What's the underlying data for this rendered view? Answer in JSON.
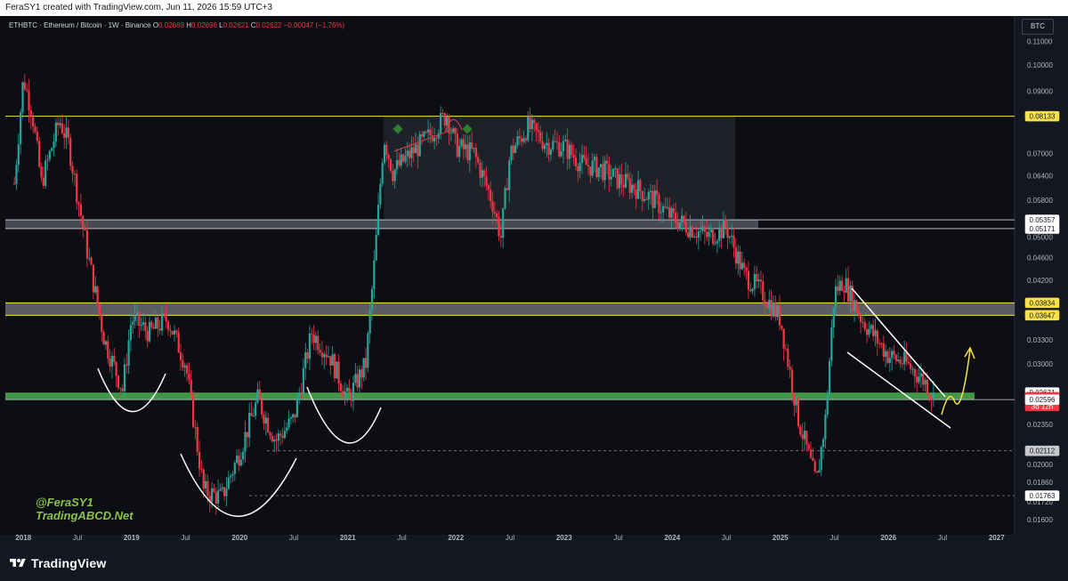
{
  "header": {
    "created_by": "FeraSY1 created with TradingView.com, Jun 11, 2026 15:59 UTC+3"
  },
  "legend": {
    "symbol": "ETHBTC · Ethereum / Bitcoin · 1W · Binance",
    "o_label": "O",
    "o_value": "0.02669",
    "h_label": "H",
    "h_value": "0.02696",
    "l_label": "L",
    "l_value": "0.02621",
    "c_label": "C",
    "c_value": "0.02622",
    "change": "−0.00047 (−1.76%)"
  },
  "currency": "BTC",
  "watermark": {
    "line1": "@FeraSY1",
    "line2": "TradingABCD.Net"
  },
  "brand": {
    "name": "TradingView"
  },
  "colors": {
    "up": "#26a69a",
    "down": "#f23645",
    "yellow": "#f7e14b",
    "green_zone": "#4caf50",
    "gray_zone": "#787b86",
    "white": "#ffffff"
  },
  "chart_data": {
    "type": "candlestick",
    "title": "ETHBTC · Ethereum / Bitcoin · 1W · Binance",
    "ylim": [
      0.0155,
      0.1175
    ],
    "y_scale": "log",
    "y_ticks": [
      "0.11000",
      "0.10000",
      "0.09000",
      "0.07000",
      "0.06400",
      "0.05800",
      "0.05000",
      "0.04600",
      "0.04200",
      "0.03300",
      "0.03000",
      "0.02350",
      "0.02000",
      "0.01860",
      "0.01720",
      "0.01600"
    ],
    "x_ticks": [
      "2018",
      "Jul",
      "2019",
      "Jul",
      "2020",
      "Jul",
      "2021",
      "Jul",
      "2022",
      "Jul",
      "2023",
      "Jul",
      "2024",
      "Jul",
      "2025",
      "Jul",
      "2026",
      "Jul",
      "2027"
    ],
    "price_path": [
      {
        "t": "2017-12",
        "p": 0.062
      },
      {
        "t": "2018-01",
        "p": 0.095
      },
      {
        "t": "2018-02",
        "p": 0.082
      },
      {
        "t": "2018-03",
        "p": 0.062
      },
      {
        "t": "2018-05",
        "p": 0.08
      },
      {
        "t": "2018-06",
        "p": 0.073
      },
      {
        "t": "2018-08",
        "p": 0.048
      },
      {
        "t": "2018-10",
        "p": 0.033
      },
      {
        "t": "2018-12",
        "p": 0.027
      },
      {
        "t": "2019-01",
        "p": 0.036
      },
      {
        "t": "2019-03",
        "p": 0.034
      },
      {
        "t": "2019-05",
        "p": 0.036
      },
      {
        "t": "2019-07",
        "p": 0.03
      },
      {
        "t": "2019-09",
        "p": 0.018
      },
      {
        "t": "2019-11",
        "p": 0.0175
      },
      {
        "t": "2020-01",
        "p": 0.021
      },
      {
        "t": "2020-03",
        "p": 0.026
      },
      {
        "t": "2020-05",
        "p": 0.022
      },
      {
        "t": "2020-07",
        "p": 0.024
      },
      {
        "t": "2020-09",
        "p": 0.034
      },
      {
        "t": "2020-11",
        "p": 0.031
      },
      {
        "t": "2021-01",
        "p": 0.026
      },
      {
        "t": "2021-03",
        "p": 0.03
      },
      {
        "t": "2021-04",
        "p": 0.046
      },
      {
        "t": "2021-05",
        "p": 0.075
      },
      {
        "t": "2021-06",
        "p": 0.065
      },
      {
        "t": "2021-08",
        "p": 0.07
      },
      {
        "t": "2021-10",
        "p": 0.075
      },
      {
        "t": "2021-12",
        "p": 0.082
      },
      {
        "t": "2022-01",
        "p": 0.072
      },
      {
        "t": "2022-03",
        "p": 0.07
      },
      {
        "t": "2022-05",
        "p": 0.058
      },
      {
        "t": "2022-06",
        "p": 0.05
      },
      {
        "t": "2022-07",
        "p": 0.07
      },
      {
        "t": "2022-09",
        "p": 0.078
      },
      {
        "t": "2022-11",
        "p": 0.073
      },
      {
        "t": "2023-01",
        "p": 0.072
      },
      {
        "t": "2023-03",
        "p": 0.067
      },
      {
        "t": "2023-05",
        "p": 0.066
      },
      {
        "t": "2023-07",
        "p": 0.063
      },
      {
        "t": "2023-09",
        "p": 0.061
      },
      {
        "t": "2023-11",
        "p": 0.058
      },
      {
        "t": "2024-01",
        "p": 0.054
      },
      {
        "t": "2024-03",
        "p": 0.052
      },
      {
        "t": "2024-05",
        "p": 0.05
      },
      {
        "t": "2024-07",
        "p": 0.052
      },
      {
        "t": "2024-09",
        "p": 0.043
      },
      {
        "t": "2024-11",
        "p": 0.04
      },
      {
        "t": "2025-01",
        "p": 0.036
      },
      {
        "t": "2025-03",
        "p": 0.024
      },
      {
        "t": "2025-05",
        "p": 0.0185
      },
      {
        "t": "2025-06",
        "p": 0.024
      },
      {
        "t": "2025-07",
        "p": 0.04
      },
      {
        "t": "2025-08",
        "p": 0.042
      },
      {
        "t": "2025-10",
        "p": 0.036
      },
      {
        "t": "2026-01",
        "p": 0.031
      },
      {
        "t": "2026-03",
        "p": 0.03
      },
      {
        "t": "2026-05",
        "p": 0.028
      },
      {
        "t": "2026-06",
        "p": 0.0262
      }
    ],
    "price_labels": [
      {
        "value": 0.08133,
        "label": "0.08133",
        "style": "yellow"
      },
      {
        "value": 0.05357,
        "label": "0.05357",
        "style": "white"
      },
      {
        "value": 0.05171,
        "label": "0.05171",
        "style": "white"
      },
      {
        "value": 0.03834,
        "label": "0.03834",
        "style": "yellow"
      },
      {
        "value": 0.03647,
        "label": "0.03647",
        "style": "yellow"
      },
      {
        "value": 0.02671,
        "label": "0.02671",
        "style": "white"
      },
      {
        "value": 0.02622,
        "label": "0.02622",
        "style": "red"
      },
      {
        "value": 0.0253,
        "label": "3d 12h",
        "style": "red"
      },
      {
        "value": 0.02596,
        "label": "0.02596",
        "style": "white"
      },
      {
        "value": 0.02112,
        "label": "0.02112",
        "style": "gray"
      },
      {
        "value": 0.01763,
        "label": "0.01763",
        "style": "white"
      }
    ],
    "zones": [
      {
        "kind": "gray",
        "from": 0.05171,
        "to": 0.05357
      },
      {
        "kind": "yellow",
        "from": 0.03647,
        "to": 0.03834
      },
      {
        "kind": "green",
        "from": 0.02596,
        "to": 0.02671
      }
    ],
    "x_range": [
      "2017-11",
      "2027-03"
    ]
  }
}
